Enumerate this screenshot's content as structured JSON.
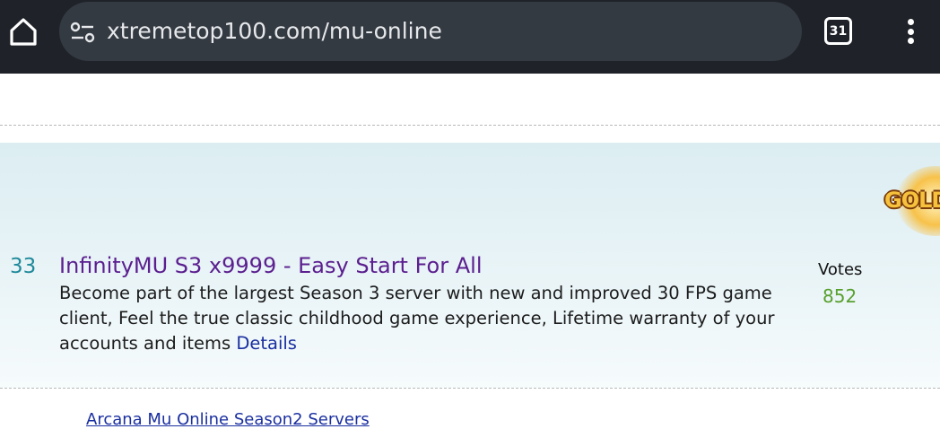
{
  "browser": {
    "url": "xtremetop100.com/mu-online",
    "tab_count": "31",
    "icons": {
      "home": "home-icon",
      "site_settings": "tune-icon",
      "tabs": "tab-switcher-icon",
      "menu": "more-vert-icon"
    }
  },
  "listing": {
    "rank": "33",
    "title": "InfinityMU S3 x9999 - Easy Start For All",
    "description": "Become part of the largest Season 3 server with new and improved 30 FPS game client, Feel the true classic childhood game experience, Lifetime warranty of your accounts and items",
    "details_link": "Details",
    "votes_label": "Votes",
    "votes_count": "852",
    "banner_text": "GOLD"
  },
  "next_listing": {
    "title": "Arcana Mu Online Season2 Servers"
  },
  "colors": {
    "topbar_bg": "#1f2329",
    "urlbar_bg": "#343a42",
    "listing_bg": "#dcedf2",
    "rank": "#1f8a9a",
    "title": "#5b1f8f",
    "link": "#1a2fa0",
    "votes": "#58a02e"
  }
}
